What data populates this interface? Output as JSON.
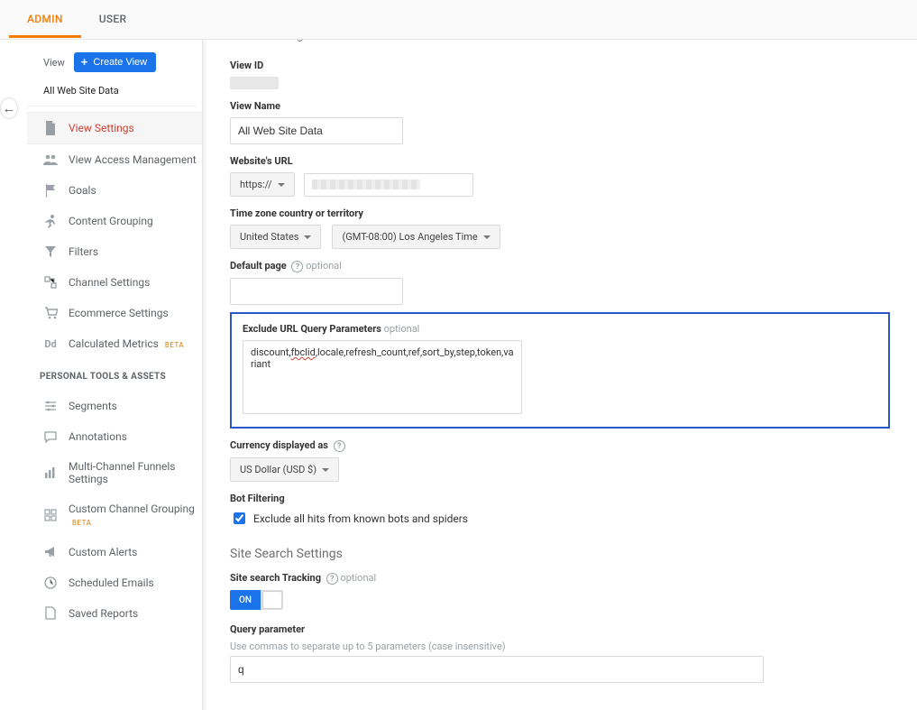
{
  "topnav": {
    "admin": "ADMIN",
    "user": "USER"
  },
  "sidebar": {
    "viewLabel": "View",
    "createView": "Create View",
    "dataSelection": "All Web Site Data",
    "items": [
      {
        "label": "View Settings"
      },
      {
        "label": "View Access Management"
      },
      {
        "label": "Goals"
      },
      {
        "label": "Content Grouping"
      },
      {
        "label": "Filters"
      },
      {
        "label": "Channel Settings"
      },
      {
        "label": "Ecommerce Settings"
      },
      {
        "label": "Calculated Metrics",
        "badge": "BETA"
      }
    ],
    "groupTitle": "PERSONAL TOOLS & ASSETS",
    "tools": [
      {
        "label": "Segments"
      },
      {
        "label": "Annotations"
      },
      {
        "label": "Multi-Channel Funnels Settings"
      },
      {
        "label": "Custom Channel Grouping",
        "badge": "BETA"
      },
      {
        "label": "Custom Alerts"
      },
      {
        "label": "Scheduled Emails"
      },
      {
        "label": "Saved Reports"
      }
    ]
  },
  "main": {
    "basicSettingsTitle": "Basic Settings",
    "viewIdLabel": "View ID",
    "viewNameLabel": "View Name",
    "viewNameValue": "All Web Site Data",
    "websiteUrlLabel": "Website's URL",
    "schemeSelected": "https://",
    "tzLabel": "Time zone country or territory",
    "tzCountry": "United States",
    "tzValue": "(GMT-08:00) Los Angeles Time",
    "defaultPageLabel": "Default page",
    "optional": "optional",
    "defaultPageValue": "",
    "excludeLabel": "Exclude URL Query Parameters",
    "excludeValuePre": "discount,",
    "excludeValueMid": "fbclid",
    "excludeValuePost": ",locale,refresh_count,ref,sort_by,step,token,variant",
    "currencyLabel": "Currency displayed as",
    "currencyValue": "US Dollar (USD $)",
    "botLabel": "Bot Filtering",
    "botCheckbox": "Exclude all hits from known bots and spiders",
    "siteSearchTitle": "Site Search Settings",
    "siteSearchTrackingLabel": "Site search Tracking",
    "toggleOn": "ON",
    "queryParamLabel": "Query parameter",
    "queryParamHint": "Use commas to separate up to 5 parameters (case insensitive)",
    "queryParamValue": "q"
  }
}
